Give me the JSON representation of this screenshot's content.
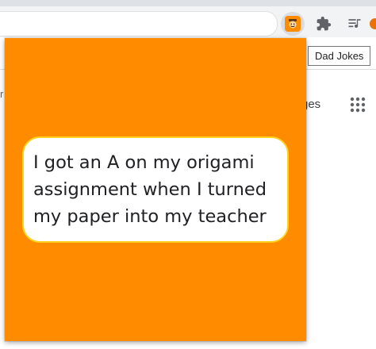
{
  "browser": {
    "tooltip": "Dad Jokes",
    "partial_text": "ges",
    "left_partial": "r",
    "icons": [
      "dad-jokes-extension-icon",
      "puzzle-icon",
      "media-control-icon",
      "apps-grid-icon"
    ]
  },
  "popup": {
    "background_color": "#ff8c00",
    "joke": "I got an A on my origami assignment when I turned my paper into my teacher"
  }
}
